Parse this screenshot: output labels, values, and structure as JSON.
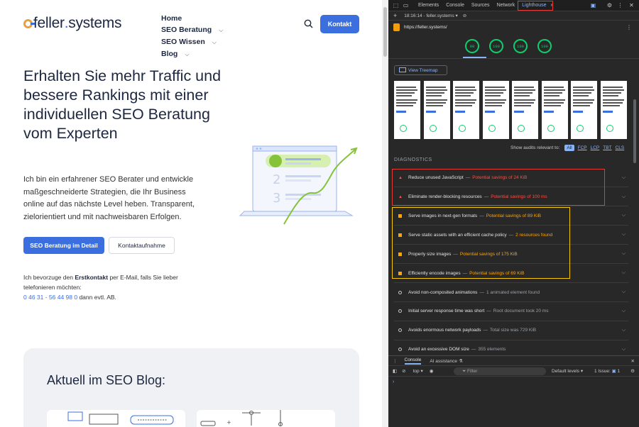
{
  "site": {
    "logo": {
      "brand": "feller",
      "dot": ".",
      "tld": "systems"
    },
    "nav": [
      {
        "label": "Home",
        "dropdown": false
      },
      {
        "label": "SEO Beratung",
        "dropdown": true
      },
      {
        "label": "SEO Wissen",
        "dropdown": true
      },
      {
        "label": "Blog",
        "dropdown": true
      }
    ],
    "contact_button": "Kontakt",
    "hero_title": "Erhalten Sie mehr Traffic und bessere Rankings mit einer individuellen SEO Beratung vom Experten",
    "hero_text": "Ich bin ein erfahrener SEO Berater und entwickle maßgeschneiderte Strategien, die Ihr Business online auf das nächste Level heben. Transparent, zielorientiert und mit nachweisbaren Erfolgen.",
    "primary_button": "SEO Beratung im Detail",
    "secondary_button": "Kontaktaufnahme",
    "contact_note": {
      "prefix": "Ich bevorzuge den ",
      "bold": "Erstkontakt",
      "suffix": " per E-Mail, falls Sie lieber telefonieren möchten:",
      "phone": "0 46 31 - 56 44 98 0",
      "after_phone": " dann evtl. AB."
    },
    "illustration_numbers": [
      "2",
      "3"
    ],
    "blog_heading": "Aktuell im SEO Blog:"
  },
  "devtools": {
    "tabs": [
      "Elements",
      "Console",
      "Sources",
      "Network",
      "Lighthouse"
    ],
    "active_tab": "Lighthouse",
    "report_selector": "18:16:14 - feller.systems",
    "url": "https://feller.systems/",
    "scores": [
      "98",
      "100",
      "100",
      "100"
    ],
    "treemap_button": "View Treemap",
    "relevant_label": "Show audits relevant to:",
    "relevant_filters": [
      "All",
      "FCP",
      "LCP",
      "TBT",
      "CLS"
    ],
    "diagnostics_label": "DIAGNOSTICS",
    "audits": [
      {
        "title": "Reduce unused JavaScript",
        "display": "Potential savings of 24 KiB",
        "rating": "fail"
      },
      {
        "title": "Eliminate render-blocking resources",
        "display": "Potential savings of 100 ms",
        "rating": "fail"
      },
      {
        "title": "Serve images in next-gen formats",
        "display": "Potential savings of 89 KiB",
        "rating": "avg"
      },
      {
        "title": "Serve static assets with an efficient cache policy",
        "display": "2 resources found",
        "rating": "avg"
      },
      {
        "title": "Properly size images",
        "display": "Potential savings of 175 KiB",
        "rating": "avg"
      },
      {
        "title": "Efficiently encode images",
        "display": "Potential savings of 69 KiB",
        "rating": "avg"
      },
      {
        "title": "Avoid non-composited animations",
        "display": "1 animated element found",
        "rating": "pass"
      },
      {
        "title": "Initial server response time was short",
        "display": "Root document took 20 ms",
        "rating": "pass"
      },
      {
        "title": "Avoids enormous network payloads",
        "display": "Total size was 729 KiB",
        "rating": "pass"
      },
      {
        "title": "Avoid an excessive DOM size",
        "display": "355 elements",
        "rating": "pass"
      }
    ],
    "drawer": {
      "tabs": [
        "Console",
        "AI assistance"
      ],
      "context": "top",
      "filter_placeholder": "Filter",
      "levels": "Default levels",
      "issues": "1 Issue:",
      "issue_count": "1"
    },
    "colors": {
      "pass": "#0cce6b",
      "fail": "#ff4e42",
      "average": "#ffa400",
      "link": "#8ab4f8",
      "highlight_red": "#e53935",
      "highlight_yellow": "#f6c90e"
    }
  }
}
